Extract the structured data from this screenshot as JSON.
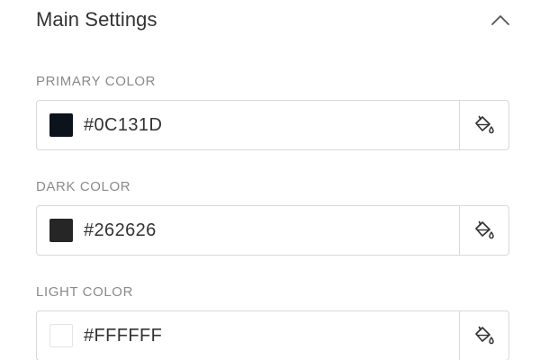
{
  "section": {
    "title": "Main Settings",
    "collapse_icon": "chevron-up-icon"
  },
  "fields": [
    {
      "label": "PRIMARY COLOR",
      "value": "#0C131D",
      "swatch_color": "#0C131D",
      "picker_icon": "paint-bucket-icon"
    },
    {
      "label": "DARK COLOR",
      "value": "#262626",
      "swatch_color": "#262626",
      "picker_icon": "paint-bucket-icon"
    },
    {
      "label": "LIGHT COLOR",
      "value": "#FFFFFF",
      "swatch_color": "#FFFFFF",
      "picker_icon": "paint-bucket-icon"
    }
  ]
}
